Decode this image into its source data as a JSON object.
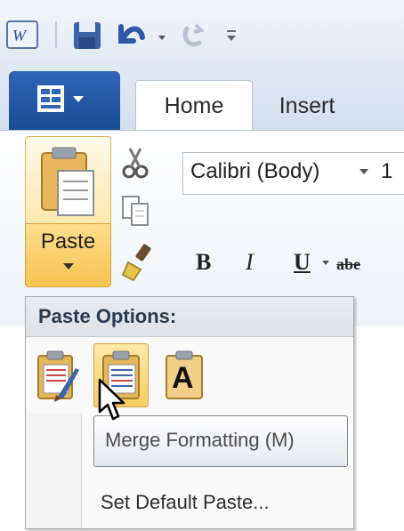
{
  "quick_access": {
    "app_icon": "word-icon",
    "save_icon": "save-icon",
    "undo_icon": "undo-icon",
    "redo_icon": "redo-icon",
    "customize_icon": "customize-qat-icon"
  },
  "tabs": {
    "file_icon": "file-menu-icon",
    "home_label": "Home",
    "insert_label": "Insert"
  },
  "ribbon": {
    "paste_label": "Paste",
    "font_name": "Calibri (Body)",
    "font_size_partial": "1",
    "bold_label": "B",
    "italic_label": "I",
    "underline_label": "U",
    "strike_label": "abe"
  },
  "paste_menu": {
    "title": "Paste Options:",
    "options": [
      {
        "icon": "keep-source-formatting-icon"
      },
      {
        "icon": "merge-formatting-icon"
      },
      {
        "icon": "keep-text-only-icon",
        "glyph": "A"
      }
    ],
    "tooltip": "Merge Formatting (M)",
    "set_default": "Set Default Paste..."
  }
}
